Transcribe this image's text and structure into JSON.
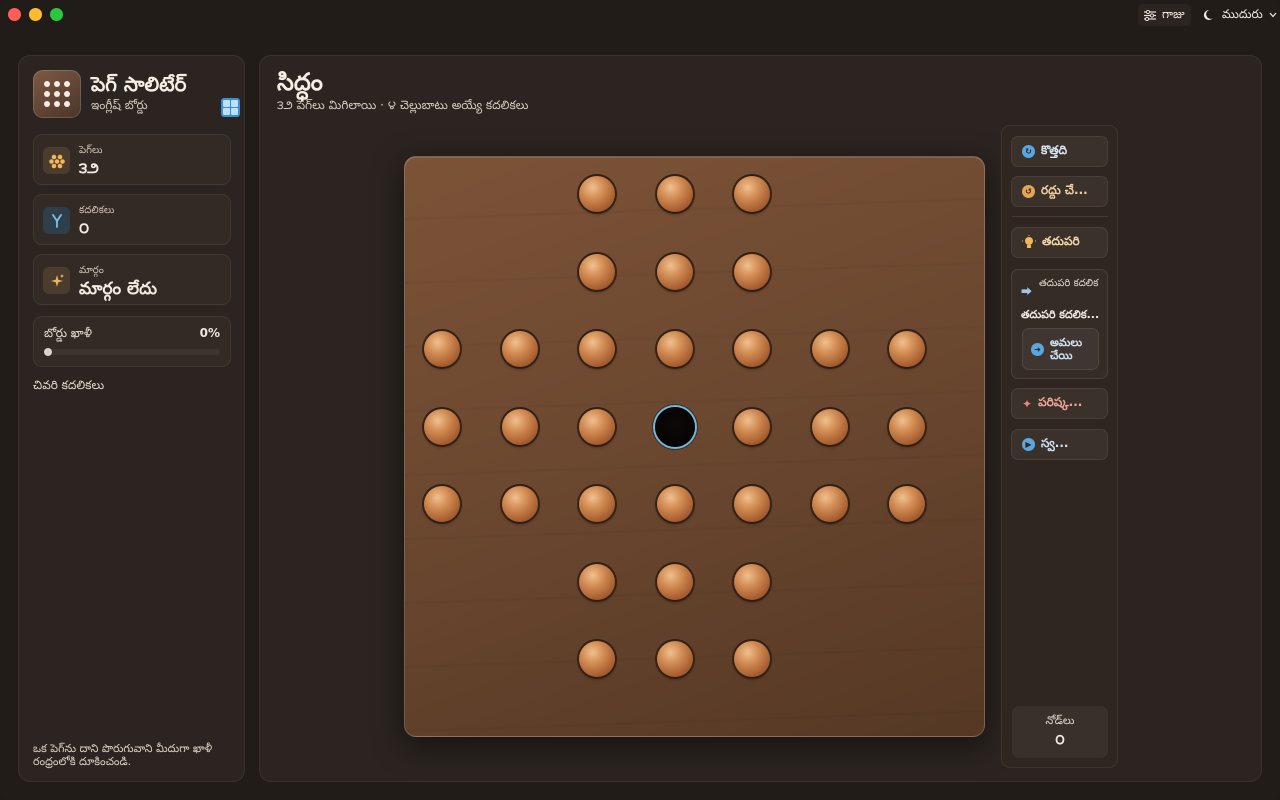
{
  "titlebar": {
    "settings_label": "గాజు",
    "theme_label": "ముదురు"
  },
  "sidebar": {
    "app_title": "పెగ్ సాలిటేర్",
    "app_subtitle": "ఇంగ్లీష్ బోర్డు",
    "stats": {
      "pegs": {
        "label": "పెగ్‌లు",
        "value": "౩౨"
      },
      "moves": {
        "label": "కదలికలు",
        "value": "౦"
      },
      "path": {
        "label": "మార్గం",
        "value": "మార్గం లేదు"
      }
    },
    "progress": {
      "label": "బోర్డు ఖాళీ",
      "value_text": "0%",
      "fraction": 0
    },
    "recent_title": "చివరి కదలికలు",
    "hint": "ఒక పెగ్‌ను దాని పొరుగువాని మీదుగా ఖాళీ రంధ్రంలోకి దూకించండి."
  },
  "main": {
    "status_title": "సిద్ధం",
    "status_subtitle": "౩౨ పెగ్‌లు మిగిలాయి · ౪ చెల్లుబాటు అయ్యే కదలికలు"
  },
  "board": {
    "rows": [
      "..XXX..",
      "..XXX..",
      "XXXXXXX",
      "XXXOXXX",
      "XXXXXXX",
      "..XXX..",
      "..XXX.."
    ],
    "empty_highlight_color": "#6fb8df"
  },
  "actions": {
    "new_label": "కొత్తది",
    "undo_label": "రద్దు చే...",
    "hint_label": "తదుపరి",
    "next_move_label": "తదుపరి కదలిక",
    "next_move_value": "తదుపరి కదలిక...",
    "apply_label": "అమలు చేయి",
    "solve_label": "పరిష్క...",
    "auto_label": "స్వ...",
    "nodes_label": "నోడ్‌లు",
    "nodes_value": "౦"
  }
}
